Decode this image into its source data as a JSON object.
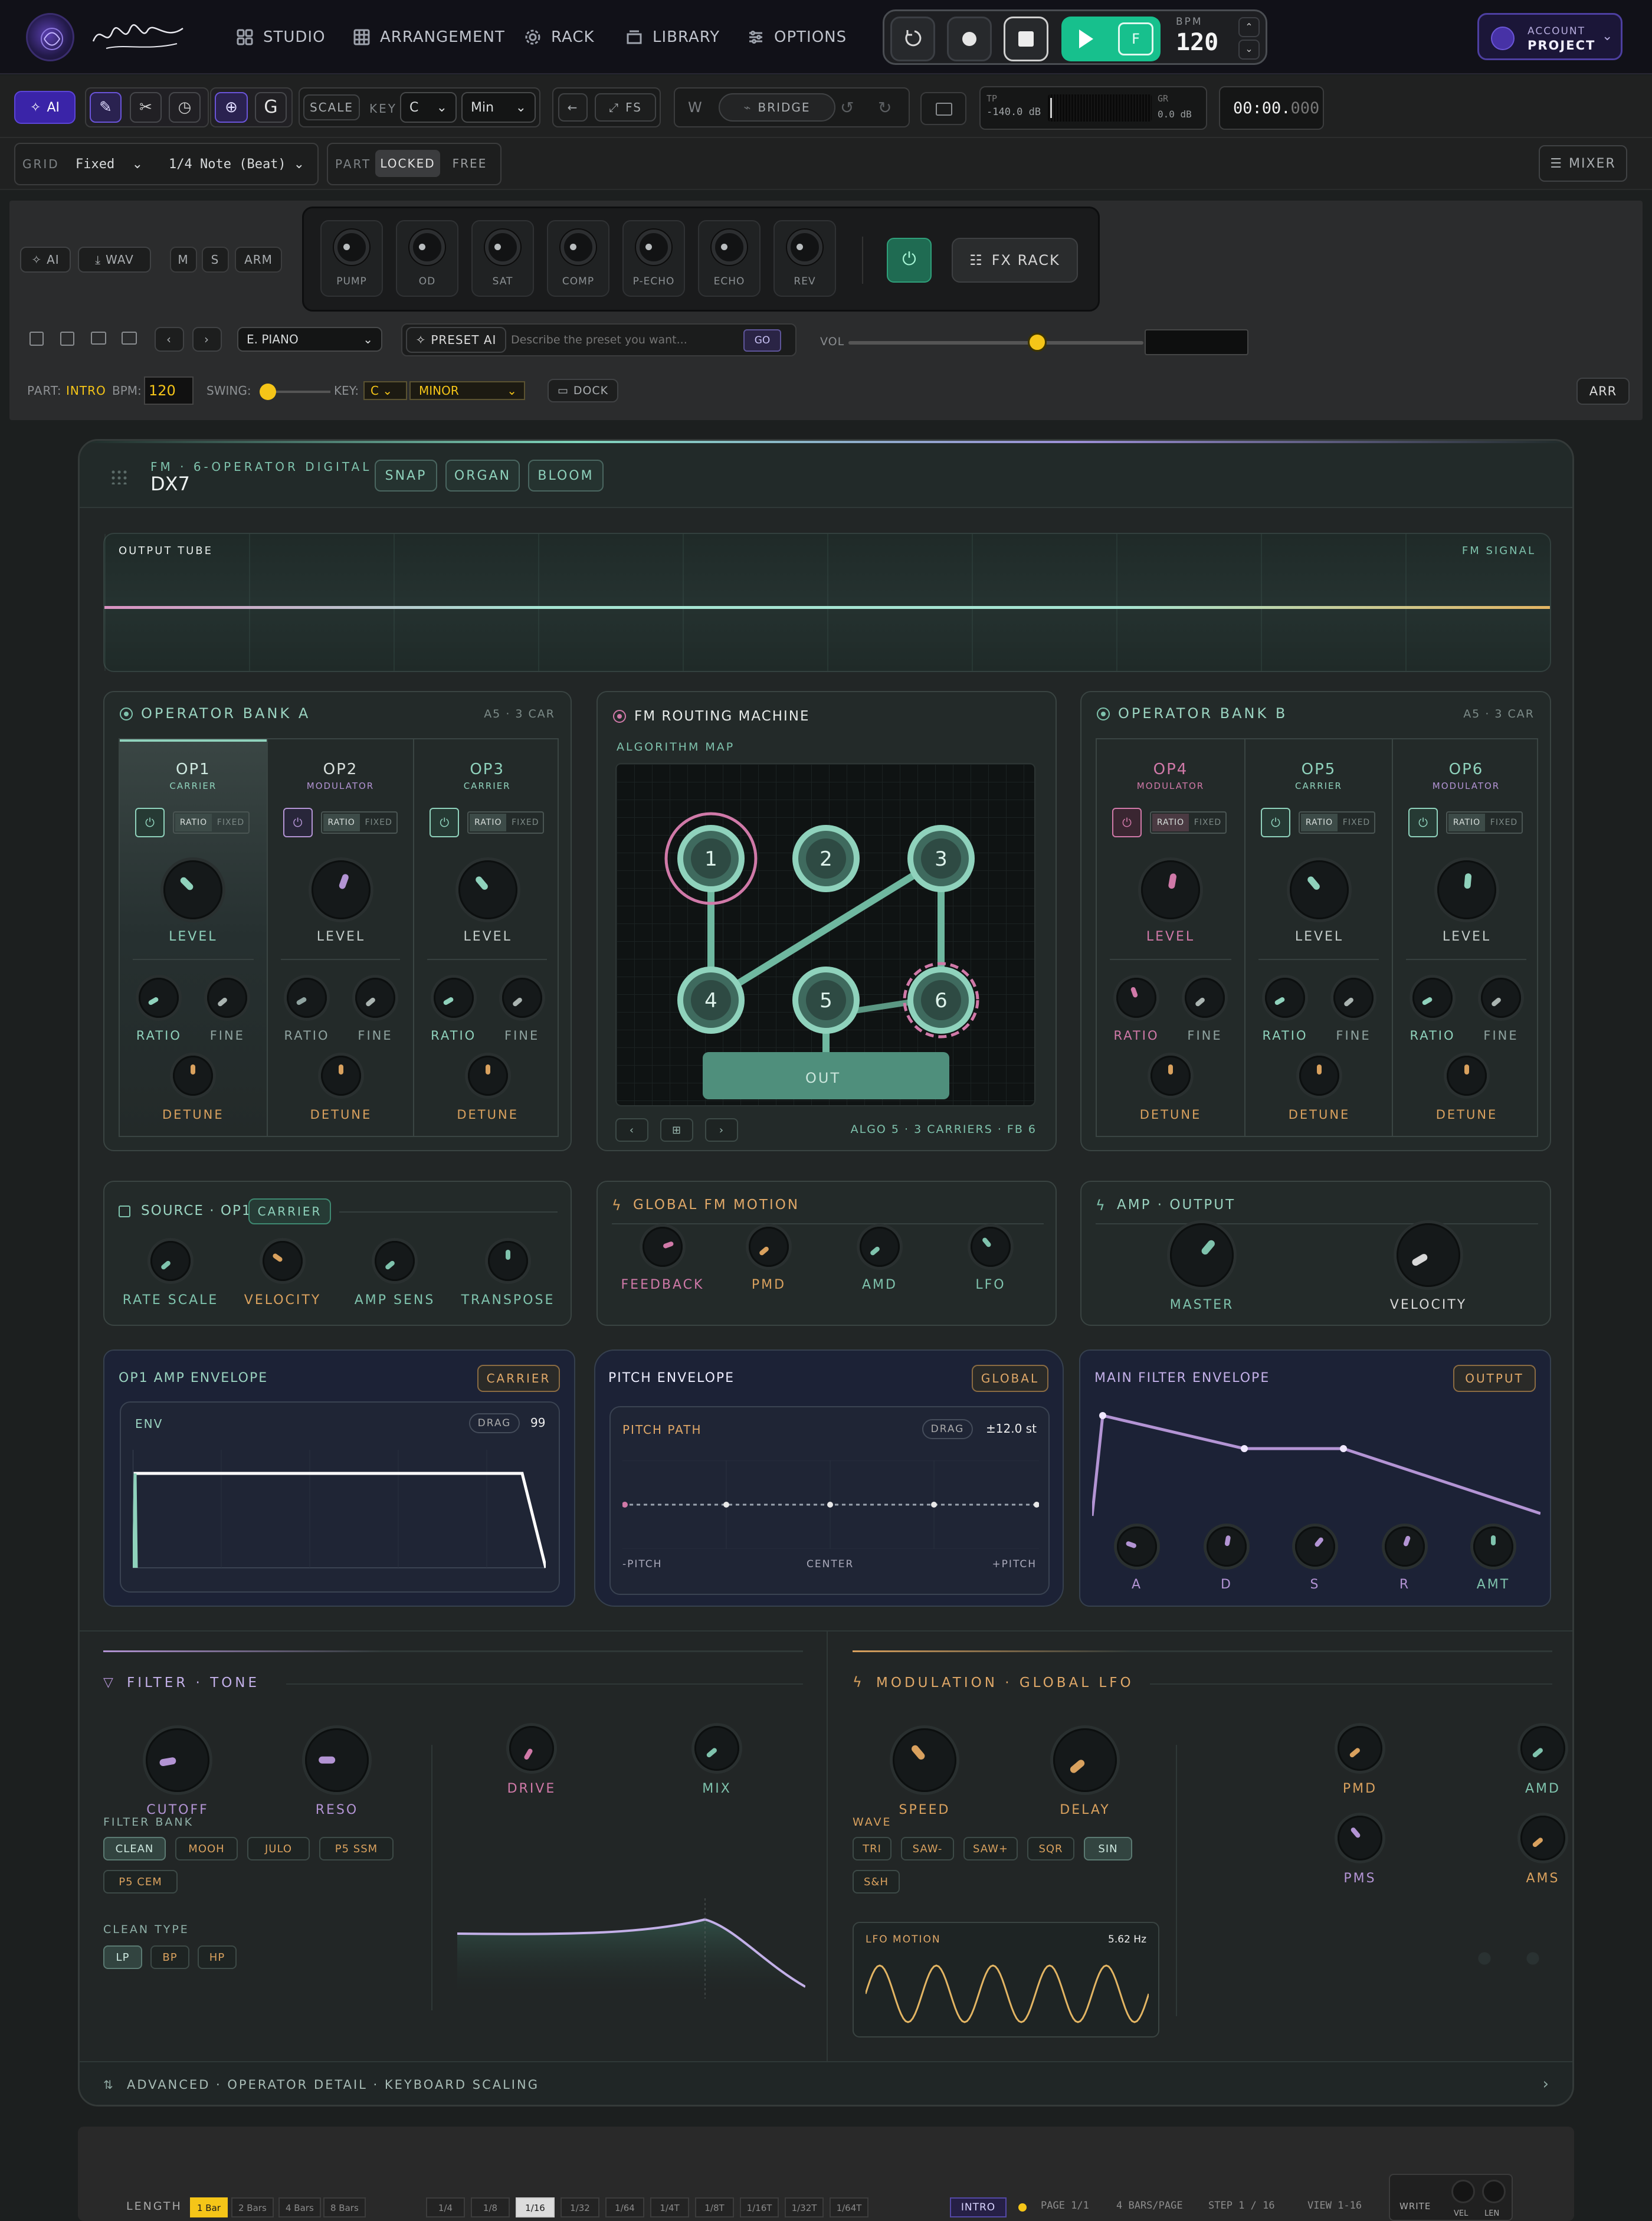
{
  "nav": {
    "items": [
      "STUDIO",
      "ARRANGEMENT",
      "RACK",
      "LIBRARY",
      "OPTIONS"
    ],
    "bpm_label": "BPM",
    "bpm_value": "120",
    "f_label": "F",
    "account_label": "ACCOUNT",
    "project_label": "PROJECT"
  },
  "toolbar": {
    "ai_label": "AI",
    "g_label": "G",
    "scale_label": "SCALE",
    "key_label": "KEY",
    "key_value": "C",
    "mode_value": "Min",
    "fs_label": "FS",
    "w_label": "W",
    "bridge_label": "BRIDGE",
    "tp_label": "TP",
    "tp_value": "-140.0 dB",
    "gr_label": "GR",
    "gr_value": "0.0 dB",
    "time_main": "00:00.",
    "time_ms": "000"
  },
  "grid_bar": {
    "grid_label": "GRID",
    "grid_value": "Fixed",
    "note_value": "1/4 Note (Beat)",
    "part_label": "PART",
    "locked_label": "LOCKED",
    "free_label": "FREE",
    "mixer_label": "MIXER"
  },
  "track": {
    "ai_label": "AI",
    "wav_label": "WAV",
    "m_label": "M",
    "s_label": "S",
    "arm_label": "ARM",
    "fx_knobs": [
      "PUMP",
      "OD",
      "SAT",
      "COMP",
      "P-ECHO",
      "ECHO",
      "REV"
    ],
    "fx_rack_label": "FX RACK",
    "preset_value": "E. PIANO",
    "preset_ai_label": "PRESET AI",
    "preset_placeholder": "Describe the preset you want...",
    "go_label": "GO",
    "vol_label": "VOL",
    "vol_level": 0.64,
    "part_label": "PART:",
    "part_value": "INTRO",
    "bpm_label": "BPM:",
    "bpm_value": "120",
    "swing_label": "SWING:",
    "key_label": "KEY:",
    "key_value": "C",
    "scale_value": "MINOR",
    "dock_label": "DOCK",
    "arr_label": "ARR"
  },
  "synth": {
    "subtitle": "FM · 6-OPERATOR DIGITAL",
    "name": "DX7",
    "presets": [
      "SNAP",
      "ORGAN",
      "BLOOM"
    ],
    "output_tube_label": "OUTPUT TUBE",
    "fm_signal_label": "FM SIGNAL",
    "bank_a": {
      "title": "OPERATOR BANK A",
      "meta": "A5 · 3 CAR",
      "ops": [
        {
          "name": "OP1",
          "role": "CARRIER"
        },
        {
          "name": "OP2",
          "role": "MODULATOR"
        },
        {
          "name": "OP3",
          "role": "CARRIER"
        }
      ]
    },
    "bank_b": {
      "title": "OPERATOR BANK B",
      "meta": "A5 · 3 CAR",
      "ops": [
        {
          "name": "OP4",
          "role": "MODULATOR"
        },
        {
          "name": "OP5",
          "role": "CARRIER"
        },
        {
          "name": "OP6",
          "role": "MODULATOR"
        }
      ]
    },
    "op_labels": {
      "ratio": "RATIO",
      "fixed": "FIXED",
      "level": "LEVEL",
      "fine": "FINE",
      "detune": "DETUNE"
    },
    "routing": {
      "title": "FM ROUTING MACHINE",
      "algo_map": "ALGORITHM MAP",
      "nodes": [
        "1",
        "2",
        "3",
        "4",
        "5",
        "6"
      ],
      "out_label": "OUT",
      "footer": "ALGO 5 · 3 CARRIERS · FB 6"
    },
    "source": {
      "title": "SOURCE · OP1",
      "badge": "CARRIER",
      "knobs": [
        "RATE SCALE",
        "VELOCITY",
        "AMP SENS",
        "TRANSPOSE"
      ]
    },
    "global_motion": {
      "title": "GLOBAL FM MOTION",
      "knobs": [
        "FEEDBACK",
        "PMD",
        "AMD",
        "LFO"
      ]
    },
    "amp_output": {
      "title": "AMP · OUTPUT",
      "knobs": [
        "MASTER",
        "VELOCITY"
      ]
    },
    "op1_env": {
      "title": "OP1 AMP ENVELOPE",
      "badge": "CARRIER",
      "env_label": "ENV",
      "drag_label": "DRAG",
      "value": "99"
    },
    "pitch_env": {
      "title": "PITCH ENVELOPE",
      "badge": "GLOBAL",
      "path_label": "PITCH PATH",
      "drag_label": "DRAG",
      "value": "±12.0 st",
      "low": "-PITCH",
      "center": "CENTER",
      "high": "+PITCH"
    },
    "filter_env": {
      "title": "MAIN FILTER ENVELOPE",
      "badge": "OUTPUT",
      "knobs": [
        "A",
        "D",
        "S",
        "R",
        "AMT"
      ]
    },
    "filter": {
      "title": "FILTER · TONE",
      "knobs": [
        "CUTOFF",
        "RESO",
        "DRIVE",
        "MIX"
      ],
      "bank_label": "FILTER BANK",
      "bank": [
        "CLEAN",
        "MOOH",
        "JULO",
        "P5 SSM",
        "P5 CEM"
      ],
      "type_label": "CLEAN TYPE",
      "types": [
        "LP",
        "BP",
        "HP"
      ]
    },
    "lfo": {
      "title": "MODULATION · GLOBAL LFO",
      "knobs": [
        "SPEED",
        "DELAY",
        "PMD",
        "AMD",
        "PMS",
        "AMS"
      ],
      "wave_label": "WAVE",
      "waves": [
        "TRI",
        "SAW-",
        "SAW+",
        "SQR",
        "SIN",
        "S&H"
      ],
      "motion_label": "LFO MOTION",
      "rate": "5.62 Hz"
    },
    "advanced_label": "ADVANCED · OPERATOR DETAIL · KEYBOARD SCALING"
  },
  "sequencer": {
    "length_label": "LENGTH",
    "lengths": [
      "1 Bar",
      "2 Bars",
      "4 Bars",
      "8 Bars"
    ],
    "divisions": [
      "1/4",
      "1/8",
      "1/16",
      "1/32",
      "1/64",
      "1/4T",
      "1/8T",
      "1/16T",
      "1/32T",
      "1/64T"
    ],
    "part_value": "INTRO",
    "page_text": "PAGE 1/1",
    "bars_per_page": "4 BARS/PAGE",
    "step_text": "STEP 1 / 16",
    "view_text": "VIEW 1-16",
    "write_label": "WRITE",
    "vel_label": "VEL",
    "len_label": "LEN"
  },
  "colors": {
    "accent_green": "#17c08d",
    "teal": "#8fd2bc",
    "orange": "#d9a15e",
    "pink": "#d079a8",
    "purple": "#b394d4",
    "yellow": "#f5c518"
  }
}
